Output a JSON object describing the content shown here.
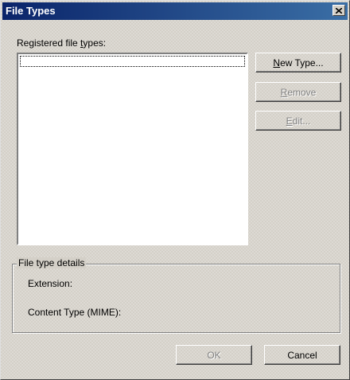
{
  "window": {
    "title": "File Types",
    "close_icon": "close-icon"
  },
  "list": {
    "label_prefix": "Registered file ",
    "label_underlined": "t",
    "label_suffix": "ypes:",
    "items": []
  },
  "buttons": {
    "new_type": {
      "u": "N",
      "rest": "ew Type..."
    },
    "remove": {
      "u": "R",
      "rest": "emove"
    },
    "edit": {
      "u": "E",
      "rest": "dit..."
    },
    "ok": "OK",
    "cancel": "Cancel"
  },
  "details": {
    "title": "File type details",
    "extension_label": "Extension:",
    "content_type_label": "Content Type (MIME):"
  },
  "colors": {
    "titlebar_start": "#0a246a",
    "titlebar_end": "#3a6ea5",
    "face": "#d4d0c8"
  }
}
